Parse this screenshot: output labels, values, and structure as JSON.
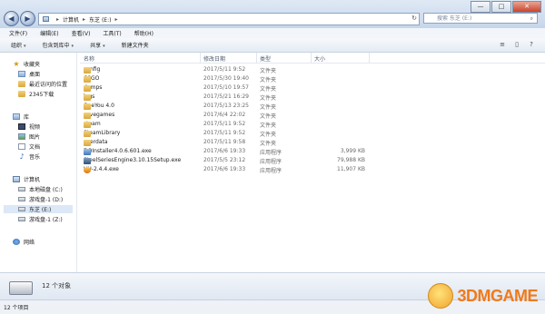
{
  "window": {
    "controls": {
      "minimize": "—",
      "maximize": "□",
      "close": "✕"
    }
  },
  "nav": {
    "back": "◀",
    "forward": "▶"
  },
  "address": {
    "segments": [
      "计算机",
      "东芝 (E:)"
    ],
    "separator": "▸",
    "refresh": "↻"
  },
  "search": {
    "placeholder": "搜索 东芝 (E:)"
  },
  "menubar": [
    "文件(F)",
    "编辑(E)",
    "查看(V)",
    "工具(T)",
    "帮助(H)"
  ],
  "toolbar": {
    "organize": "组织",
    "include_in_library": "包含到库中",
    "share": "共享",
    "new_folder": "新建文件夹",
    "caret": "▾",
    "right": [
      "≡",
      "▯",
      "?"
    ]
  },
  "sidebar": {
    "favorites": {
      "label": "收藏夹",
      "items": [
        "桌面",
        "最近访问的位置",
        "2345下载"
      ]
    },
    "libraries": {
      "label": "库",
      "items": [
        "视频",
        "图片",
        "文档",
        "音乐"
      ]
    },
    "computer": {
      "label": "计算机",
      "items": [
        "本地磁盘 (C:)",
        "游戏盘-1 (D:)",
        "东芝 (E:)",
        "游戏盘-1 (Z:)"
      ]
    },
    "network": {
      "label": "网络"
    }
  },
  "columns": {
    "name": "名称",
    "date": "修改日期",
    "type": "类型",
    "size": "大小"
  },
  "files": [
    {
      "name": "config",
      "date": "2017/5/11 9:52",
      "type": "文件夹",
      "size": "",
      "kind": "folder"
    },
    {
      "name": "CSGO",
      "date": "2017/5/30 19:40",
      "type": "文件夹",
      "size": "",
      "kind": "folder"
    },
    {
      "name": "dumps",
      "date": "2017/5/10 19:57",
      "type": "文件夹",
      "size": "",
      "kind": "folder"
    },
    {
      "name": "logs",
      "date": "2017/5/21 16:29",
      "type": "文件夹",
      "size": "",
      "kind": "folder"
    },
    {
      "name": "QeeYou 4.0",
      "date": "2017/5/13 23:25",
      "type": "文件夹",
      "size": "",
      "kind": "folder"
    },
    {
      "name": "savegames",
      "date": "2017/6/4 22:02",
      "type": "文件夹",
      "size": "",
      "kind": "folder"
    },
    {
      "name": "steam",
      "date": "2017/5/11 9:52",
      "type": "文件夹",
      "size": "",
      "kind": "folder"
    },
    {
      "name": "SteamLibrary",
      "date": "2017/5/11 9:52",
      "type": "文件夹",
      "size": "",
      "kind": "folder"
    },
    {
      "name": "userdata",
      "date": "2017/5/11 9:58",
      "type": "文件夹",
      "size": "",
      "kind": "folder"
    },
    {
      "name": "DQInstaller4.0.6.601.exe",
      "date": "2017/6/6 19:33",
      "type": "应用程序",
      "size": "3,999 KB",
      "kind": "exe"
    },
    {
      "name": "SteelSeriesEngine3.10.15Setup.exe",
      "date": "2017/5/5 23:12",
      "type": "应用程序",
      "size": "79,988 KB",
      "kind": "exe2"
    },
    {
      "name": "UU-2.4.4.exe",
      "date": "2017/6/6 19:33",
      "type": "应用程序",
      "size": "11,907 KB",
      "kind": "exe3"
    }
  ],
  "details": {
    "count": "12 个对象"
  },
  "status": {
    "text": "12 个项目"
  },
  "watermark": {
    "text": "3DMGAME"
  }
}
